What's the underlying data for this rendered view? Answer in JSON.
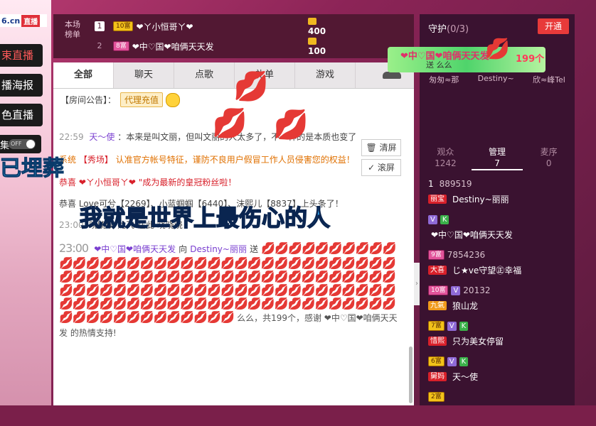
{
  "left": {
    "domain": "6.cn",
    "live_badge": "直播",
    "buttons": [
      "束直播",
      "播海报",
      "色直播",
      "集"
    ],
    "toggle": "OFF"
  },
  "rank": {
    "label": "本场榜单",
    "rows": [
      {
        "num": "1",
        "level": "10富",
        "name": "❤ㄚ小恒哥ㄚ❤",
        "coins": "400"
      },
      {
        "num": "2",
        "level": "8富",
        "name": "❤中♡国❤咱俩天天发",
        "coins": "100"
      }
    ]
  },
  "tabs": [
    "全部",
    "聊天",
    "点歌",
    "礼单",
    "游戏"
  ],
  "notice": {
    "label": "【房间公告】：",
    "btn": "代理充值"
  },
  "messages": [
    {
      "time": "22:59",
      "user": "天～使",
      "text": "：本来是叫文丽，但叫文丽的人太多了，不一样的是本质也变了"
    },
    {
      "prefix": "系统",
      "tag": "【秀场】",
      "text": "认准官方帐号特征，谨防不良用户假冒工作人员侵害您的权益！"
    },
    {
      "text": "恭喜",
      "user": "❤ㄚ小恒哥ㄚ❤",
      "tail": "\"成为最新的皇冠粉丝啦！"
    },
    {
      "text": "恭喜 Love可兮【2269】、小蓝蝈蝈【6440】、沫熙儿【8837】上头条了！"
    },
    {
      "time": "23:00",
      "text": "晓晓晓 龙飞 在此 晓晓晓"
    }
  ],
  "gift_msg": {
    "time": "23:00",
    "from": "❤中♡国❤咱俩天天发",
    "to_label": "向",
    "to": "Destiny~丽丽",
    "send": "送",
    "tail": "么么，共199个，感谢 ❤中♡国❤咱俩天天发 的热情支持!"
  },
  "chat_buttons": {
    "clear": "清屏",
    "scroll": "滚屏"
  },
  "right": {
    "guard_title": "守护",
    "guard_count": "(0/3)",
    "open_btn": "开通",
    "guards": [
      "匆匆≈那",
      "Destiny~",
      "欣≈峰Tel"
    ],
    "vtabs": [
      {
        "label": "观众",
        "count": "1242"
      },
      {
        "label": "管理",
        "count": "7"
      },
      {
        "label": "麦序",
        "count": "0"
      }
    ],
    "users": [
      {
        "lvl": "1",
        "uid": "889519",
        "tag": "丽宝",
        "name": "Destiny~丽丽"
      },
      {
        "lvl": "",
        "uid": "",
        "tag": "",
        "name": "❤中♡国❤咱俩天天发"
      },
      {
        "lvl": "9富",
        "uid": "7854236",
        "tag": "大喜",
        "name": "じ★ve守望㊣幸福"
      },
      {
        "lvl": "10富",
        "uid": "20132",
        "tag": "九氣",
        "name": "狼山龙"
      },
      {
        "lvl": "7富",
        "uid": "",
        "tag": "惜熙",
        "name": "只为美女停留"
      },
      {
        "lvl": "6富",
        "uid": "",
        "tag": "舅妈",
        "name": "天～使"
      },
      {
        "lvl": "2富",
        "uid": "",
        "tag": "",
        "name": ""
      }
    ]
  },
  "gift_banner": {
    "line1": "❤中♡国❤咱俩天天发",
    "line2": "送 么么",
    "count": "199个"
  },
  "overlay": {
    "line1": "已埋葬",
    "line2": "我就是世界上最伤心的人"
  }
}
